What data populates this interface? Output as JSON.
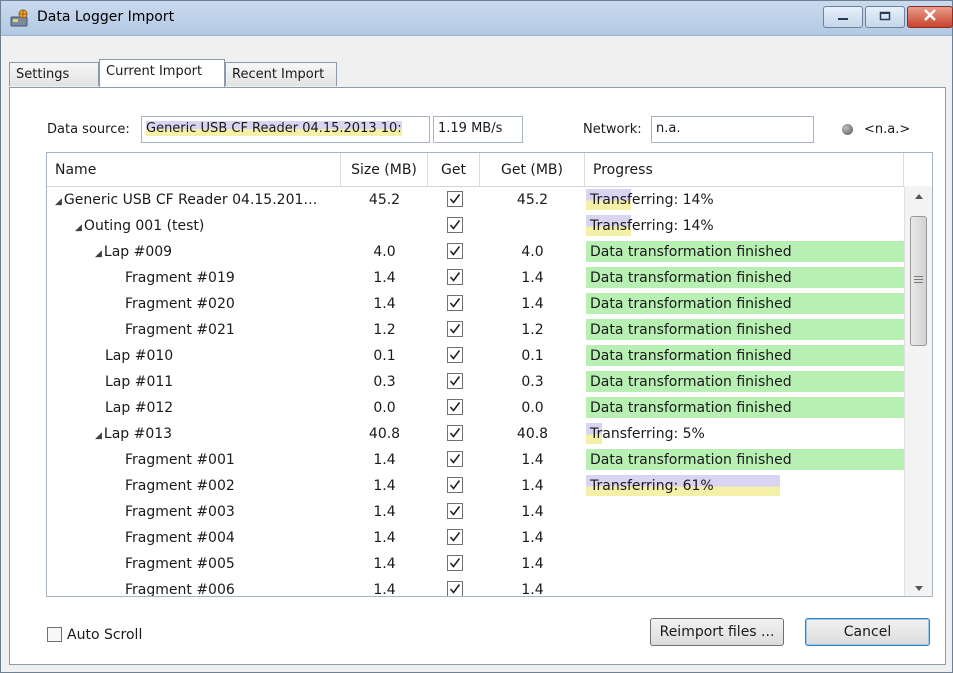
{
  "window": {
    "title": "Data Logger Import"
  },
  "tabs": [
    "Settings",
    "Current Import",
    "Recent Import"
  ],
  "active_tab": "Current Import",
  "source": {
    "label": "Data source:",
    "device": "Generic USB CF Reader 04.15.2013 10:",
    "speed": "1.19 MB/s",
    "network_label": "Network:",
    "network_value": "n.a.",
    "status": "<n.a.>"
  },
  "table": {
    "headers": [
      "Name",
      "Size (MB)",
      "Get",
      "Get (MB)",
      "Progress"
    ],
    "rows": [
      {
        "name": "Generic USB CF Reader 04.15.201…",
        "indent": 0,
        "expander": "◢",
        "size": "45.2",
        "checked": true,
        "get": "45.2",
        "progress": "Transferring: 14%",
        "state": "part",
        "pct": 14
      },
      {
        "name": "Outing 001 (test)",
        "indent": 1,
        "expander": "◢",
        "size": "",
        "checked": true,
        "get": "",
        "progress": "Transferring: 14%",
        "state": "part",
        "pct": 14
      },
      {
        "name": "Lap #009",
        "indent": 2,
        "expander": "◢",
        "size": "4.0",
        "checked": true,
        "get": "4.0",
        "progress": "Data transformation finished",
        "state": "done",
        "pct": 100
      },
      {
        "name": "Fragment #019",
        "indent": 3,
        "expander": "",
        "size": "1.4",
        "checked": true,
        "get": "1.4",
        "progress": "Data transformation finished",
        "state": "done",
        "pct": 100
      },
      {
        "name": "Fragment #020",
        "indent": 3,
        "expander": "",
        "size": "1.4",
        "checked": true,
        "get": "1.4",
        "progress": "Data transformation finished",
        "state": "done",
        "pct": 100
      },
      {
        "name": "Fragment #021",
        "indent": 3,
        "expander": "",
        "size": "1.2",
        "checked": true,
        "get": "1.2",
        "progress": "Data transformation finished",
        "state": "done",
        "pct": 100
      },
      {
        "name": "Lap #010",
        "indent": 2,
        "expander": "",
        "size": "0.1",
        "checked": true,
        "get": "0.1",
        "progress": "Data transformation finished",
        "state": "done",
        "pct": 100
      },
      {
        "name": "Lap #011",
        "indent": 2,
        "expander": "",
        "size": "0.3",
        "checked": true,
        "get": "0.3",
        "progress": "Data transformation finished",
        "state": "done",
        "pct": 100
      },
      {
        "name": "Lap #012",
        "indent": 2,
        "expander": "",
        "size": "0.0",
        "checked": true,
        "get": "0.0",
        "progress": "Data transformation finished",
        "state": "done",
        "pct": 100
      },
      {
        "name": "Lap #013",
        "indent": 2,
        "expander": "◢",
        "size": "40.8",
        "checked": true,
        "get": "40.8",
        "progress": "Transferring: 5%",
        "state": "part",
        "pct": 5
      },
      {
        "name": "Fragment #001",
        "indent": 3,
        "expander": "",
        "size": "1.4",
        "checked": true,
        "get": "1.4",
        "progress": "Data transformation finished",
        "state": "done",
        "pct": 100
      },
      {
        "name": "Fragment #002",
        "indent": 3,
        "expander": "",
        "size": "1.4",
        "checked": true,
        "get": "1.4",
        "progress": "Transferring: 61%",
        "state": "part",
        "pct": 61
      },
      {
        "name": "Fragment #003",
        "indent": 3,
        "expander": "",
        "size": "1.4",
        "checked": true,
        "get": "1.4",
        "progress": "",
        "state": "none",
        "pct": 0
      },
      {
        "name": "Fragment #004",
        "indent": 3,
        "expander": "",
        "size": "1.4",
        "checked": true,
        "get": "1.4",
        "progress": "",
        "state": "none",
        "pct": 0
      },
      {
        "name": "Fragment #005",
        "indent": 3,
        "expander": "",
        "size": "1.4",
        "checked": true,
        "get": "1.4",
        "progress": "",
        "state": "none",
        "pct": 0
      },
      {
        "name": "Fragment #006",
        "indent": 3,
        "expander": "",
        "size": "1.4",
        "checked": true,
        "get": "1.4",
        "progress": "",
        "state": "none",
        "pct": 0
      }
    ]
  },
  "auto_scroll": {
    "label": "Auto Scroll",
    "checked": false
  },
  "buttons": {
    "reimport": "Reimport files ...",
    "cancel": "Cancel"
  },
  "colors": {
    "finished": "#b8f0b4",
    "transfer_top": "#d8d4f2",
    "transfer_bottom": "#f4f0a8",
    "titlebar": "#c9daee"
  }
}
